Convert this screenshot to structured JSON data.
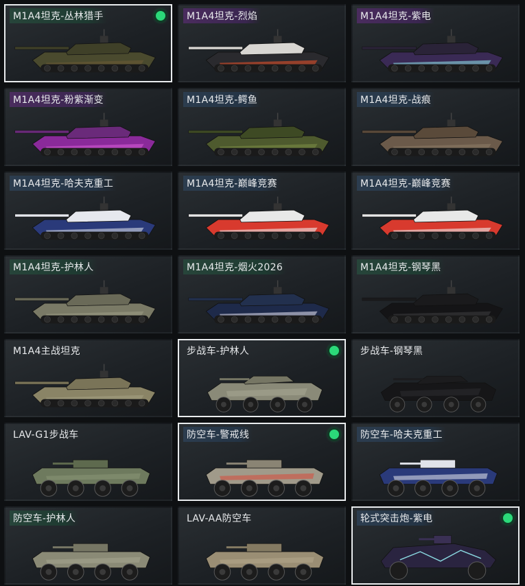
{
  "skins": [
    {
      "label": "M1A4坦克-丛林猎手",
      "tag": "green",
      "selected": true,
      "equipped": true,
      "kind": "tank",
      "body": "#4a4a2e",
      "accent": "#6b5a35",
      "turret": "#3f4028"
    },
    {
      "label": "M1A4坦克-烈焰",
      "tag": "purple",
      "selected": false,
      "equipped": false,
      "kind": "tank",
      "body": "#2a2a2e",
      "accent": "#e0502a",
      "turret": "#d8d6d2"
    },
    {
      "label": "M1A4坦克-紫电",
      "tag": "purple",
      "selected": false,
      "equipped": false,
      "kind": "tank",
      "body": "#3a2a55",
      "accent": "#8ad8e0",
      "turret": "#2a2338"
    },
    {
      "label": "M1A4坦克-粉紫渐变",
      "tag": "purple",
      "selected": false,
      "equipped": false,
      "kind": "tank",
      "body": "#8a2a9a",
      "accent": "#d45ad6",
      "turret": "#6a2a7a"
    },
    {
      "label": "M1A4坦克-鳄鱼",
      "tag": "slate",
      "selected": false,
      "equipped": false,
      "kind": "tank",
      "body": "#4e5a2e",
      "accent": "#7a8a44",
      "turret": "#3e4a24"
    },
    {
      "label": "M1A4坦克-战痕",
      "tag": "slate",
      "selected": false,
      "equipped": false,
      "kind": "tank",
      "body": "#6b5a4a",
      "accent": "#8a7a66",
      "turret": "#5a4a3a"
    },
    {
      "label": "M1A4坦克-哈夫克重工",
      "tag": "slate",
      "selected": false,
      "equipped": false,
      "kind": "tank",
      "body": "#2a3a7a",
      "accent": "#d8dce6",
      "turret": "#e6e8ee"
    },
    {
      "label": "M1A4坦克-巅峰竞赛",
      "tag": "slate",
      "selected": false,
      "equipped": false,
      "kind": "tank",
      "body": "#d83a2e",
      "accent": "#eeeeee",
      "turret": "#e8e8e8"
    },
    {
      "label": "M1A4坦克-巅峰竞赛",
      "tag": "slate",
      "selected": false,
      "equipped": false,
      "kind": "tank",
      "body": "#d83a2e",
      "accent": "#eeeeee",
      "turret": "#e8e8e8"
    },
    {
      "label": "M1A4坦克-护林人",
      "tag": "green",
      "selected": false,
      "equipped": false,
      "kind": "tank",
      "body": "#7a7a66",
      "accent": "#9a9a82",
      "turret": "#6a6a58"
    },
    {
      "label": "M1A4坦克-烟火2026",
      "tag": "green",
      "selected": false,
      "equipped": false,
      "kind": "tank",
      "body": "#1e2a4a",
      "accent": "#d8d8e8",
      "turret": "#22304e"
    },
    {
      "label": "M1A4坦克-钢琴黑",
      "tag": "green",
      "selected": false,
      "equipped": false,
      "kind": "tank",
      "body": "#141416",
      "accent": "#3a3a3e",
      "turret": "#1a1a1c"
    },
    {
      "label": "M1A4主战坦克",
      "tag": "none",
      "selected": false,
      "equipped": false,
      "kind": "tank",
      "body": "#8a8466",
      "accent": "#a49e80",
      "turret": "#7a7458"
    },
    {
      "label": "步战车-护林人",
      "tag": "none",
      "selected": true,
      "equipped": true,
      "kind": "ifv",
      "body": "#8a8a78",
      "accent": "#a8a894",
      "turret": "#767664"
    },
    {
      "label": "步战车-钢琴黑",
      "tag": "none",
      "selected": false,
      "equipped": false,
      "kind": "ifv",
      "body": "#161618",
      "accent": "#2e2e32",
      "turret": "#1c1c1e"
    },
    {
      "label": "LAV-G1步战车",
      "tag": "none",
      "selected": false,
      "equipped": false,
      "kind": "apc",
      "body": "#6e7a5e",
      "accent": "#8a9676",
      "turret": "#5e6a4e"
    },
    {
      "label": "防空车-警戒线",
      "tag": "slate",
      "selected": true,
      "equipped": true,
      "kind": "apc",
      "body": "#a09a8a",
      "accent": "#d84a3a",
      "turret": "#8a8474"
    },
    {
      "label": "防空车-哈夫克重工",
      "tag": "slate",
      "selected": false,
      "equipped": false,
      "kind": "apc",
      "body": "#2a3a7a",
      "accent": "#e6e8ee",
      "turret": "#e0e2ea"
    },
    {
      "label": "防空车-护林人",
      "tag": "green",
      "selected": false,
      "equipped": false,
      "kind": "apc",
      "body": "#8a8a76",
      "accent": "#a6a690",
      "turret": "#767664"
    },
    {
      "label": "LAV-AA防空车",
      "tag": "none",
      "selected": false,
      "equipped": false,
      "kind": "apc",
      "body": "#9a8e74",
      "accent": "#b4a88c",
      "turret": "#847a62"
    },
    {
      "label": "轮式突击炮-紫电",
      "tag": "slate",
      "selected": true,
      "equipped": true,
      "kind": "buggy",
      "body": "#2a2440",
      "accent": "#8ad8e0",
      "turret": "#3a3054"
    }
  ]
}
